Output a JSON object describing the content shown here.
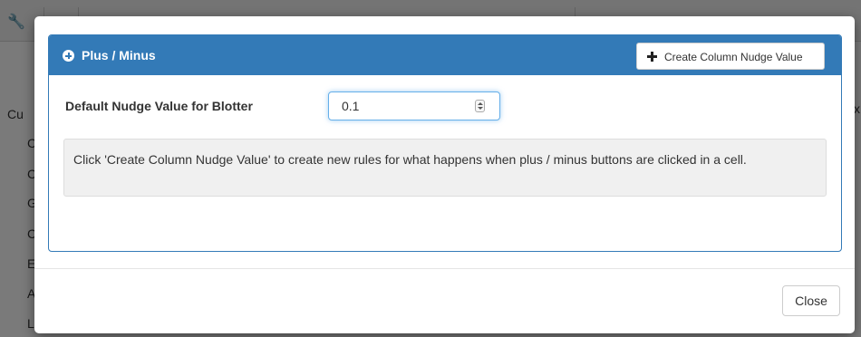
{
  "background": {
    "heading_fragment": "Cu",
    "item_fragments": [
      "C",
      "C",
      "G",
      "C",
      "E",
      "A",
      "L"
    ],
    "right_fragment": "x"
  },
  "panel": {
    "title": "Plus / Minus",
    "title_icon": "plus-circle-icon",
    "create_button_label": "Create Column Nudge Value",
    "create_button_icon": "plus-icon",
    "accent_color": "#337ab7"
  },
  "form": {
    "nudge_label": "Default Nudge Value for Blotter",
    "nudge_value": "0.1"
  },
  "info": {
    "text": "Click 'Create Column Nudge Value' to create new rules for what happens when plus / minus buttons are clicked in a cell."
  },
  "footer": {
    "close_label": "Close"
  }
}
